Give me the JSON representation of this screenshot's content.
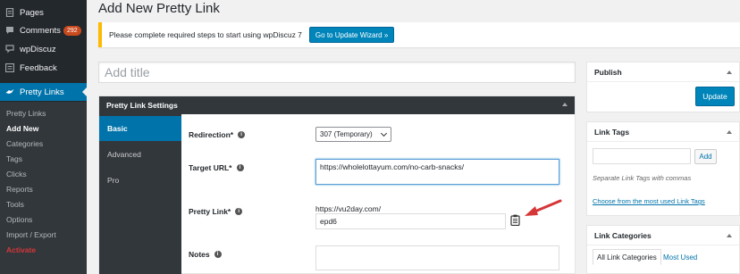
{
  "sidebar": {
    "menu": [
      {
        "label": "Pages",
        "icon": "pages-icon"
      },
      {
        "label": "Comments",
        "icon": "comments-icon",
        "badge": "292"
      },
      {
        "label": "wpDiscuz",
        "icon": "wpdiscuz-icon"
      },
      {
        "label": "Feedback",
        "icon": "feedback-icon"
      },
      {
        "label": "Pretty Links",
        "icon": "pretty-links-icon"
      }
    ],
    "submenu": [
      "Pretty Links",
      "Add New",
      "Categories",
      "Tags",
      "Clicks",
      "Reports",
      "Tools",
      "Options",
      "Import / Export",
      "Activate"
    ]
  },
  "page": {
    "title": "Add New Pretty Link",
    "notice": "Please complete required steps to start using wpDiscuz 7",
    "wizard_button": "Go to Update Wizard »",
    "title_placeholder": "Add title"
  },
  "settings": {
    "header": "Pretty Link Settings",
    "tabs": [
      "Basic",
      "Advanced",
      "Pro"
    ],
    "redirection_label": "Redirection*",
    "redirection_value": "307 (Temporary)",
    "target_url_label": "Target URL*",
    "target_url_value": "https://wholelottayum.com/no-carb-snacks/",
    "pretty_link_label": "Pretty Link*",
    "pretty_link_prefix": "https://vu2day.com/",
    "pretty_link_slug": "epd6",
    "notes_label": "Notes"
  },
  "publish": {
    "title": "Publish",
    "update_button": "Update"
  },
  "link_tags": {
    "title": "Link Tags",
    "add_button": "Add",
    "help": "Separate Link Tags with commas",
    "choose_link": "Choose from the most used Link Tags"
  },
  "link_categories": {
    "title": "Link Categories",
    "tab_all": "All Link Categories",
    "tab_used": "Most Used"
  },
  "colors": {
    "accent": "#0073aa",
    "sidebar": "#23282d",
    "notice_border": "#ffb900",
    "arrow": "#d63638"
  }
}
